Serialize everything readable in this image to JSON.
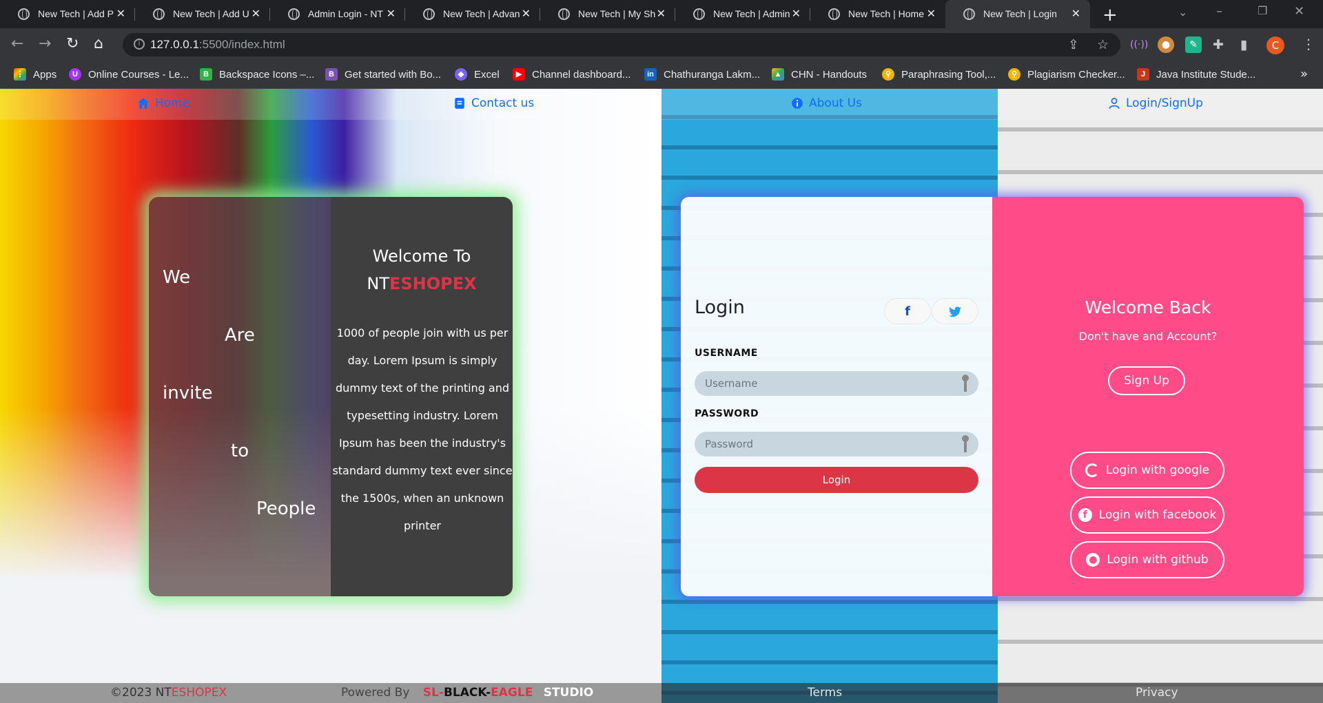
{
  "browser": {
    "tabs": [
      {
        "title": "New Tech | Add P"
      },
      {
        "title": "New Tech | Add U"
      },
      {
        "title": "Admin Login - NT"
      },
      {
        "title": "New Tech | Advan"
      },
      {
        "title": "New Tech | My Sh"
      },
      {
        "title": "New Tech | Admin"
      },
      {
        "title": "New Tech | Home"
      },
      {
        "title": "New Tech | Login"
      }
    ],
    "url_host": "127.0.0.1",
    "url_path": ":5500/index.html",
    "profile_initial": "C",
    "bookmarks": [
      {
        "label": "Apps",
        "icon": "apps-grid-icon"
      },
      {
        "label": "Online Courses - Le...",
        "icon": "udemy-icon"
      },
      {
        "label": "Backspace Icons –...",
        "icon": "backspace-icon"
      },
      {
        "label": "Get started with Bo...",
        "icon": "bootstrap-icon"
      },
      {
        "label": "Excel",
        "icon": "excel-icon"
      },
      {
        "label": "Channel dashboard...",
        "icon": "youtube-icon"
      },
      {
        "label": "Chathuranga Lakm...",
        "icon": "linkedin-icon"
      },
      {
        "label": "CHN - Handouts",
        "icon": "google-drive-icon"
      },
      {
        "label": "Paraphrasing Tool,...",
        "icon": "magnifier-icon"
      },
      {
        "label": "Plagiarism Checker...",
        "icon": "magnifier-icon"
      },
      {
        "label": "Java Institute Stude...",
        "icon": "java-icon"
      }
    ]
  },
  "nav": {
    "home": "Home",
    "contact": "Contact us",
    "about": "About Us",
    "login": "Login/SignUp"
  },
  "invite": {
    "words": [
      "We",
      "Are",
      "invite",
      "to",
      "People"
    ],
    "welcome_line": "Welcome To",
    "brand_a": "NT",
    "brand_b": "ESHOPEX",
    "paragraph": "1000 of people join with us per day. Lorem Ipsum is simply dummy text of the printing and typesetting industry. Lorem Ipsum has been the industry's standard dummy text ever since the 1500s, when an unknown printer"
  },
  "login": {
    "title": "Login",
    "username_label": "USERNAME",
    "username_placeholder": "Username",
    "password_label": "PASSWORD",
    "password_placeholder": "Password",
    "button": "Login"
  },
  "welcome_back": {
    "title": "Welcome Back",
    "subtitle": "Don't have and Account?",
    "signup": "Sign Up",
    "google": "Login with google",
    "facebook": "Login with facebook",
    "github": "Login with github"
  },
  "footer": {
    "copyright_a": "©2023 NT",
    "copyright_b": "ESHOPEX",
    "powered_by": "Powered By",
    "studio_a": "SL-",
    "studio_b": "BLACK-",
    "studio_c": "EAGLE",
    "studio_d": "STUDIO",
    "terms": "Terms",
    "privacy": "Privacy"
  },
  "colors": {
    "brand_red": "#dc3545",
    "link_blue": "#0d6efd",
    "pink_panel": "#ff4b87",
    "card_glow_green": "#90ee90",
    "card_glow_purple": "#6450f0"
  }
}
